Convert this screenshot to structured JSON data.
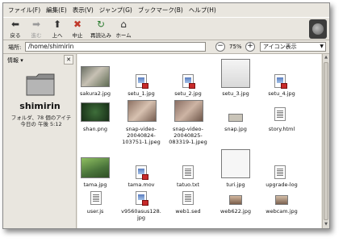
{
  "menubar": [
    {
      "label": "ファイル(F)"
    },
    {
      "label": "編集(E)"
    },
    {
      "label": "表示(V)"
    },
    {
      "label": "ジャンプ(G)"
    },
    {
      "label": "ブックマーク(B)"
    },
    {
      "label": "ヘルプ(H)"
    }
  ],
  "toolbar": {
    "back_label": "戻る",
    "forward_label": "進む",
    "up_label": "上へ",
    "stop_label": "中止",
    "reload_label": "再読込み",
    "home_label": "ホーム"
  },
  "location": {
    "label": "場所:",
    "value": "/home/shimirin",
    "zoom": "75%",
    "view_mode": "アイコン表示"
  },
  "sidepane": {
    "title": "情報 ▾",
    "folder_name": "shimirin",
    "folder_info_line1": "フォルダ、78 個のアイテ",
    "folder_info_line2": "今日の 午後 5:12"
  },
  "files": [
    {
      "name": "sakura2.jpg"
    },
    {
      "name": "setu_1.jpg"
    },
    {
      "name": "setu_2.jpg"
    },
    {
      "name": "setu_3.jpg"
    },
    {
      "name": "setu_4.jpg"
    },
    {
      "name": "shan.png"
    },
    {
      "name": "snap-video-\n20040824-\n103751-1.jpeg"
    },
    {
      "name": "snap-video-\n20040825-\n083319-1.jpeg"
    },
    {
      "name": "snap.jpg"
    },
    {
      "name": "story.html"
    },
    {
      "name": "tama.jpg"
    },
    {
      "name": "tama.mov"
    },
    {
      "name": "tatuo.txt"
    },
    {
      "name": "turi.jpg"
    },
    {
      "name": "upgrade-log"
    },
    {
      "name": "user.js"
    },
    {
      "name": "v9560asus128.\njpg"
    },
    {
      "name": "web1.sed"
    },
    {
      "name": "web622.jpg"
    },
    {
      "name": "webcam.jpg"
    }
  ],
  "colors": {
    "accent": "#e9e6df",
    "view_bg": "#ffffff"
  }
}
